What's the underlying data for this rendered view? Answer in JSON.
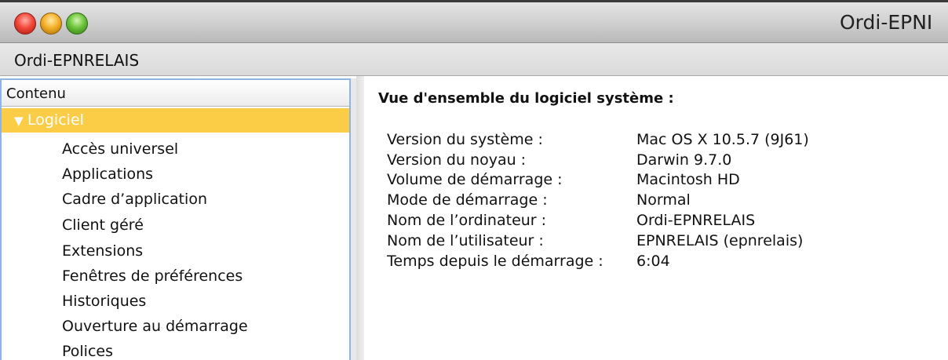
{
  "window": {
    "title": "Ordi-EPNI"
  },
  "toolbar": {
    "computer_name": "Ordi-EPNRELAIS"
  },
  "sidebar": {
    "header": "Contenu",
    "selected": {
      "label": "Logiciel",
      "icon": "disclosure-triangle-down-icon"
    },
    "items": [
      "Accès universel",
      "Applications",
      "Cadre d’application",
      "Client géré",
      "Extensions",
      "Fenêtres de préférences",
      "Historiques",
      "Ouverture au démarrage",
      "Polices"
    ]
  },
  "main": {
    "heading": "Vue d'ensemble du logiciel système :",
    "rows": [
      {
        "label": "Version du système :",
        "value": "Mac OS X 10.5.7 (9J61)"
      },
      {
        "label": "Version du noyau :",
        "value": "Darwin 9.7.0"
      },
      {
        "label": "Volume de démarrage :",
        "value": "Macintosh HD"
      },
      {
        "label": "Mode de démarrage :",
        "value": "Normal"
      },
      {
        "label": "Nom de l’ordinateur :",
        "value": "Ordi-EPNRELAIS"
      },
      {
        "label": "Nom de l’utilisateur :",
        "value": "EPNRELAIS (epnrelais)"
      },
      {
        "label": "Temps depuis le démarrage :",
        "value": "6:04"
      }
    ]
  },
  "colors": {
    "selection": "#fbcd47",
    "focus_ring": "#8fb3e2"
  }
}
